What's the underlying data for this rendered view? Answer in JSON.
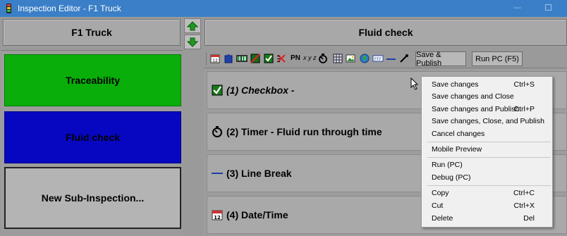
{
  "window": {
    "title": "Inspection Editor - F1 Truck"
  },
  "header": {
    "left_title": "F1 Truck",
    "right_title": "Fluid check"
  },
  "cards": [
    {
      "label": "Traceability",
      "color": "#0aae0a"
    },
    {
      "label": "Fluid check",
      "color": "#0707c2"
    },
    {
      "label": "New Sub-Inspection..."
    }
  ],
  "toolbar": {
    "icons": [
      "calendar-icon",
      "badge-icon",
      "barcode-icon",
      "diagonal-box-icon",
      "checkbox-icon",
      "multi-check-icon",
      "pn-icon",
      "xyz-icon",
      "timer-icon",
      "grid-icon",
      "image-icon",
      "globe-icon",
      "text-field-icon",
      "line-break-icon",
      "signature-icon"
    ],
    "pn_label": "PN",
    "xyz_label": "x y z",
    "save_publish_label": "Save & Publish",
    "run_pc_label": "Run PC (F5)"
  },
  "rows": [
    {
      "text": "(1) Checkbox -",
      "icon": "checkbox-icon"
    },
    {
      "text": "(2) Timer - Fluid run through time",
      "icon": "timer-icon"
    },
    {
      "text": "(3) Line Break",
      "icon": "line-break-icon"
    },
    {
      "text": "(4) Date/Time",
      "icon": "calendar-icon"
    }
  ],
  "context_menu": {
    "items": [
      {
        "label": "Save changes",
        "shortcut": "Ctrl+S"
      },
      {
        "label": "Save changes and Close",
        "shortcut": ""
      },
      {
        "label": "Save changes and Publish",
        "shortcut": "Ctrl+P"
      },
      {
        "label": "Save changes, Close, and Publish",
        "shortcut": ""
      },
      {
        "label": "Cancel changes",
        "shortcut": ""
      },
      {
        "label": "Mobile Preview",
        "shortcut": ""
      },
      {
        "label": "Run (PC)",
        "shortcut": ""
      },
      {
        "label": "Debug (PC)",
        "shortcut": ""
      },
      {
        "label": "Copy",
        "shortcut": "Ctrl+C"
      },
      {
        "label": "Cut",
        "shortcut": "Ctrl+X"
      },
      {
        "label": "Delete",
        "shortcut": "Del"
      }
    ]
  },
  "colors": {
    "titlebar": "#3a7fc7",
    "green": "#0aae0a",
    "blue": "#0707c2"
  }
}
